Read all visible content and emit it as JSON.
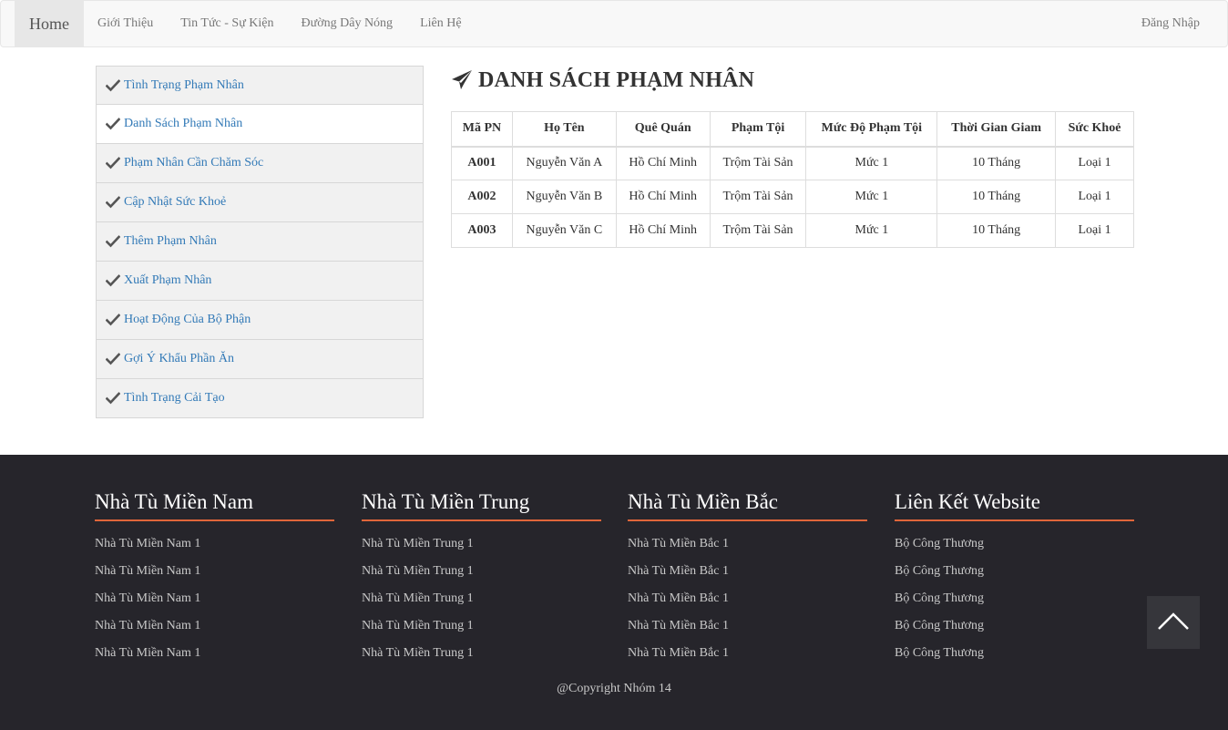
{
  "navbar": {
    "brand": "Home",
    "items": [
      {
        "label": "Giới Thiệu"
      },
      {
        "label": "Tin Tức - Sự Kiện"
      },
      {
        "label": "Đường Dây Nóng"
      },
      {
        "label": "Liên Hệ"
      }
    ],
    "login": "Đăng Nhập"
  },
  "sidebar": {
    "items": [
      {
        "label": "Tình Trạng Phạm Nhân"
      },
      {
        "label": "Danh Sách Phạm Nhân"
      },
      {
        "label": "Phạm Nhân Cần Chăm Sóc"
      },
      {
        "label": "Cập Nhật Sức Khoẻ"
      },
      {
        "label": "Thêm Phạm Nhân"
      },
      {
        "label": "Xuất Phạm Nhân"
      },
      {
        "label": "Hoạt Động Của Bộ Phận"
      },
      {
        "label": "Gợi Ý Khẩu Phần Ăn"
      },
      {
        "label": "Tình Trạng Cải Tạo"
      }
    ],
    "icon": "check-icon"
  },
  "main": {
    "title": "DANH SÁCH PHẠM NHÂN",
    "title_icon": "paper-plane-icon",
    "table": {
      "headers": [
        "Mã PN",
        "Họ Tên",
        "Quê Quán",
        "Phạm Tội",
        "Mức Độ Phạm Tội",
        "Thời Gian Giam",
        "Sức Khoẻ"
      ],
      "rows": [
        [
          "A001",
          "Nguyễn Văn A",
          "Hồ Chí Minh",
          "Trộm Tài Sản",
          "Mức 1",
          "10 Tháng",
          "Loại 1"
        ],
        [
          "A002",
          "Nguyễn Văn B",
          "Hồ Chí Minh",
          "Trộm Tài Sản",
          "Mức 1",
          "10 Tháng",
          "Loại 1"
        ],
        [
          "A003",
          "Nguyễn Văn C",
          "Hồ Chí Minh",
          "Trộm Tài Sản",
          "Mức 1",
          "10 Tháng",
          "Loại 1"
        ]
      ]
    }
  },
  "footer": {
    "columns": [
      {
        "title": "Nhà Tù Miền Nam",
        "links": [
          "Nhà Tù Miền Nam 1",
          "Nhà Tù Miền Nam 1",
          "Nhà Tù Miền Nam 1",
          "Nhà Tù Miền Nam 1",
          "Nhà Tù Miền Nam 1"
        ]
      },
      {
        "title": "Nhà Tù Miền Trung",
        "links": [
          "Nhà Tù Miền Trung 1",
          "Nhà Tù Miền Trung 1",
          "Nhà Tù Miền Trung 1",
          "Nhà Tù Miền Trung 1",
          "Nhà Tù Miền Trung 1"
        ]
      },
      {
        "title": "Nhà Tù Miền Bắc",
        "links": [
          "Nhà Tù Miền Bắc 1",
          "Nhà Tù Miền Bắc 1",
          "Nhà Tù Miền Bắc 1",
          "Nhà Tù Miền Bắc 1",
          "Nhà Tù Miền Bắc 1"
        ]
      },
      {
        "title": "Liên Kết Website",
        "links": [
          "Bộ Công Thương",
          "Bộ Công Thương",
          "Bộ Công Thương",
          "Bộ Công Thương",
          "Bộ Công Thương"
        ]
      }
    ],
    "copyright": "@Copyright Nhóm 14",
    "back_to_top_icon": "chevron-up-icon"
  },
  "colors": {
    "link": "#337ab7",
    "footer_bg": "#26252b",
    "footer_accent": "#e0663a",
    "navbar_bg": "#f8f8f8"
  }
}
